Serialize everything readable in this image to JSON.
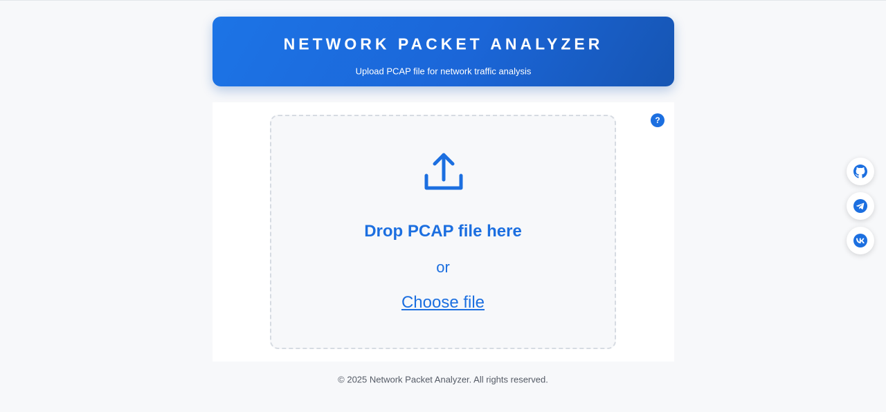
{
  "header": {
    "title": "NETWORK PACKET ANALYZER",
    "subtitle": "Upload PCAP file for network traffic analysis"
  },
  "help": {
    "label": "?"
  },
  "dropzone": {
    "icon": "upload-icon",
    "drop_text": "Drop PCAP file here",
    "or_text": "or",
    "choose_label": "Choose file"
  },
  "footer": {
    "text": "© 2025 Network Packet Analyzer. All rights reserved."
  },
  "social": [
    {
      "name": "github",
      "icon": "github-icon"
    },
    {
      "name": "telegram",
      "icon": "telegram-icon"
    },
    {
      "name": "vk",
      "icon": "vk-icon"
    }
  ],
  "colors": {
    "accent": "#1c6fe0",
    "header_gradient_start": "#1c74e6",
    "header_gradient_end": "#1655b3",
    "page_bg": "#f7f8fa",
    "dropzone_border": "#d6dbe2"
  }
}
